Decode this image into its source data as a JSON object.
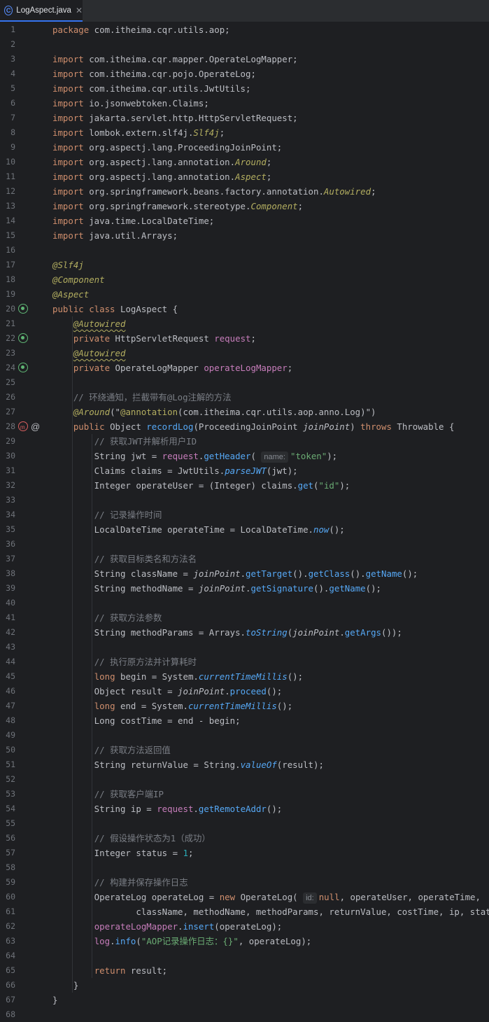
{
  "tab": {
    "icon": "class-icon",
    "label": "LogAspect.java",
    "close_icon": "close-icon"
  },
  "hints": {
    "name": "name:",
    "id": "id:"
  },
  "lines": [
    [
      [
        "kw",
        "package"
      ],
      [
        "t",
        " com.itheima.cqr.utils.aop;"
      ]
    ],
    [],
    [
      [
        "kw",
        "import"
      ],
      [
        "t",
        " com.itheima.cqr.mapper.OperateLogMapper;"
      ]
    ],
    [
      [
        "kw",
        "import"
      ],
      [
        "t",
        " com.itheima.cqr.pojo.OperateLog;"
      ]
    ],
    [
      [
        "kw",
        "import"
      ],
      [
        "t",
        " com.itheima.cqr.utils.JwtUtils;"
      ]
    ],
    [
      [
        "kw",
        "import"
      ],
      [
        "t",
        " io.jsonwebtoken.Claims;"
      ]
    ],
    [
      [
        "kw",
        "import"
      ],
      [
        "t",
        " jakarta.servlet.http.HttpServletRequest;"
      ]
    ],
    [
      [
        "kw",
        "import"
      ],
      [
        "t",
        " lombok.extern.slf4j."
      ],
      [
        "an it",
        "Slf4j"
      ],
      [
        "t",
        ";"
      ]
    ],
    [
      [
        "kw",
        "import"
      ],
      [
        "t",
        " org.aspectj.lang.ProceedingJoinPoint;"
      ]
    ],
    [
      [
        "kw",
        "import"
      ],
      [
        "t",
        " org.aspectj.lang.annotation."
      ],
      [
        "an it",
        "Around"
      ],
      [
        "t",
        ";"
      ]
    ],
    [
      [
        "kw",
        "import"
      ],
      [
        "t",
        " org.aspectj.lang.annotation."
      ],
      [
        "an it",
        "Aspect"
      ],
      [
        "t",
        ";"
      ]
    ],
    [
      [
        "kw",
        "import"
      ],
      [
        "t",
        " org.springframework.beans.factory.annotation."
      ],
      [
        "an it",
        "Autowired"
      ],
      [
        "t",
        ";"
      ]
    ],
    [
      [
        "kw",
        "import"
      ],
      [
        "t",
        " org.springframework.stereotype."
      ],
      [
        "an it",
        "Component"
      ],
      [
        "t",
        ";"
      ]
    ],
    [
      [
        "kw",
        "import"
      ],
      [
        "t",
        " java.time.LocalDateTime;"
      ]
    ],
    [
      [
        "kw",
        "import"
      ],
      [
        "t",
        " java.util.Arrays;"
      ]
    ],
    [],
    [
      [
        "an it",
        "@Slf4j"
      ]
    ],
    [
      [
        "an it",
        "@Component"
      ]
    ],
    [
      [
        "an it",
        "@Aspect"
      ]
    ],
    [
      [
        "kw",
        "public class"
      ],
      [
        "t",
        " LogAspect {"
      ]
    ],
    [
      [
        "t",
        "    "
      ],
      [
        "an it sq",
        "@Autowired"
      ]
    ],
    [
      [
        "t",
        "    "
      ],
      [
        "kw",
        "private"
      ],
      [
        "t",
        " HttpServletRequest "
      ],
      [
        "fld",
        "request"
      ],
      [
        "t",
        ";"
      ]
    ],
    [
      [
        "t",
        "    "
      ],
      [
        "an it sq",
        "@Autowired"
      ]
    ],
    [
      [
        "t",
        "    "
      ],
      [
        "kw",
        "private"
      ],
      [
        "t",
        " OperateLogMapper "
      ],
      [
        "fld",
        "operateLogMapper"
      ],
      [
        "t",
        ";"
      ]
    ],
    [],
    [
      [
        "t",
        "    "
      ],
      [
        "cm",
        "// 环绕通知，拦截带有@Log注解的方法"
      ]
    ],
    [
      [
        "t",
        "    "
      ],
      [
        "an it",
        "@Around"
      ],
      [
        "t",
        "(\""
      ],
      [
        "an",
        "@annotation"
      ],
      [
        "t",
        "(com.itheima.cqr.utils.aop.anno.Log)\")"
      ]
    ],
    [
      [
        "t",
        "    "
      ],
      [
        "kw",
        "public"
      ],
      [
        "t",
        " Object "
      ],
      [
        "fn",
        "recordLog"
      ],
      [
        "t",
        "(ProceedingJoinPoint "
      ],
      [
        "pm",
        "joinPoint"
      ],
      [
        "t",
        ") "
      ],
      [
        "kw",
        "throws"
      ],
      [
        "t",
        " Throwable {"
      ]
    ],
    [
      [
        "t",
        "        "
      ],
      [
        "cm",
        "// 获取JWT并解析用户ID"
      ]
    ],
    [
      [
        "t",
        "        String jwt = "
      ],
      [
        "fld",
        "request"
      ],
      [
        "t",
        "."
      ],
      [
        "fn",
        "getHeader"
      ],
      [
        "t",
        "( "
      ],
      [
        "hint",
        "name:"
      ],
      [
        "str",
        "\"token\""
      ],
      [
        "t",
        ");"
      ]
    ],
    [
      [
        "t",
        "        Claims claims = JwtUtils."
      ],
      [
        "fn it",
        "parseJWT"
      ],
      [
        "t",
        "(jwt);"
      ]
    ],
    [
      [
        "t",
        "        Integer operateUser = (Integer) claims."
      ],
      [
        "fn",
        "get"
      ],
      [
        "t",
        "("
      ],
      [
        "str",
        "\"id\""
      ],
      [
        "t",
        ");"
      ]
    ],
    [],
    [
      [
        "t",
        "        "
      ],
      [
        "cm",
        "// 记录操作时间"
      ]
    ],
    [
      [
        "t",
        "        LocalDateTime operateTime = LocalDateTime."
      ],
      [
        "fn it",
        "now"
      ],
      [
        "t",
        "();"
      ]
    ],
    [],
    [
      [
        "t",
        "        "
      ],
      [
        "cm",
        "// 获取目标类名和方法名"
      ]
    ],
    [
      [
        "t",
        "        String className = "
      ],
      [
        "pm",
        "joinPoint"
      ],
      [
        "t",
        "."
      ],
      [
        "fn",
        "getTarget"
      ],
      [
        "t",
        "()."
      ],
      [
        "fn",
        "getClass"
      ],
      [
        "t",
        "()."
      ],
      [
        "fn",
        "getName"
      ],
      [
        "t",
        "();"
      ]
    ],
    [
      [
        "t",
        "        String methodName = "
      ],
      [
        "pm",
        "joinPoint"
      ],
      [
        "t",
        "."
      ],
      [
        "fn",
        "getSignature"
      ],
      [
        "t",
        "()."
      ],
      [
        "fn",
        "getName"
      ],
      [
        "t",
        "();"
      ]
    ],
    [],
    [
      [
        "t",
        "        "
      ],
      [
        "cm",
        "// 获取方法参数"
      ]
    ],
    [
      [
        "t",
        "        String methodParams = Arrays."
      ],
      [
        "fn it",
        "toString"
      ],
      [
        "t",
        "("
      ],
      [
        "pm",
        "joinPoint"
      ],
      [
        "t",
        "."
      ],
      [
        "fn",
        "getArgs"
      ],
      [
        "t",
        "());"
      ]
    ],
    [],
    [
      [
        "t",
        "        "
      ],
      [
        "cm",
        "// 执行原方法并计算耗时"
      ]
    ],
    [
      [
        "t",
        "        "
      ],
      [
        "kw",
        "long"
      ],
      [
        "t",
        " begin = System."
      ],
      [
        "fn it",
        "currentTimeMillis"
      ],
      [
        "t",
        "();"
      ]
    ],
    [
      [
        "t",
        "        Object result = "
      ],
      [
        "pm",
        "joinPoint"
      ],
      [
        "t",
        "."
      ],
      [
        "fn",
        "proceed"
      ],
      [
        "t",
        "();"
      ]
    ],
    [
      [
        "t",
        "        "
      ],
      [
        "kw",
        "long"
      ],
      [
        "t",
        " end = System."
      ],
      [
        "fn it",
        "currentTimeMillis"
      ],
      [
        "t",
        "();"
      ]
    ],
    [
      [
        "t",
        "        Long costTime = end - begin;"
      ]
    ],
    [],
    [
      [
        "t",
        "        "
      ],
      [
        "cm",
        "// 获取方法返回值"
      ]
    ],
    [
      [
        "t",
        "        String returnValue = String."
      ],
      [
        "fn it",
        "valueOf"
      ],
      [
        "t",
        "(result);"
      ]
    ],
    [],
    [
      [
        "t",
        "        "
      ],
      [
        "cm",
        "// 获取客户端IP"
      ]
    ],
    [
      [
        "t",
        "        String ip = "
      ],
      [
        "fld",
        "request"
      ],
      [
        "t",
        "."
      ],
      [
        "fn",
        "getRemoteAddr"
      ],
      [
        "t",
        "();"
      ]
    ],
    [],
    [
      [
        "t",
        "        "
      ],
      [
        "cm",
        "// 假设操作状态为1（成功）"
      ]
    ],
    [
      [
        "t",
        "        Integer status = "
      ],
      [
        "num",
        "1"
      ],
      [
        "t",
        ";"
      ]
    ],
    [],
    [
      [
        "t",
        "        "
      ],
      [
        "cm",
        "// 构建并保存操作日志"
      ]
    ],
    [
      [
        "t",
        "        OperateLog operateLog = "
      ],
      [
        "kw",
        "new"
      ],
      [
        "t",
        " OperateLog( "
      ],
      [
        "hint",
        "id:"
      ],
      [
        "kw",
        "null"
      ],
      [
        "t",
        ", operateUser, operateTime,"
      ]
    ],
    [
      [
        "t",
        "                className, methodName, methodParams, returnValue, costTime, ip, status);"
      ]
    ],
    [
      [
        "t",
        "        "
      ],
      [
        "fld",
        "operateLogMapper"
      ],
      [
        "t",
        "."
      ],
      [
        "fn",
        "insert"
      ],
      [
        "t",
        "(operateLog);"
      ]
    ],
    [
      [
        "t",
        "        "
      ],
      [
        "fld",
        "log"
      ],
      [
        "t",
        "."
      ],
      [
        "fn",
        "info"
      ],
      [
        "t",
        "("
      ],
      [
        "str",
        "\"AOP记录操作日志：{}\""
      ],
      [
        "t",
        ", operateLog);"
      ]
    ],
    [],
    [
      [
        "t",
        "        "
      ],
      [
        "kw",
        "return"
      ],
      [
        "t",
        " result;"
      ]
    ],
    [
      [
        "t",
        "    }"
      ]
    ],
    [
      [
        "t",
        "}"
      ]
    ],
    []
  ],
  "gutter_icons": [
    {
      "line": 20,
      "icons": [
        "spring-bean-icon"
      ]
    },
    {
      "line": 22,
      "icons": [
        "autowired-bean-icon"
      ]
    },
    {
      "line": 24,
      "icons": [
        "autowired-bean-icon"
      ]
    },
    {
      "line": 28,
      "icons": [
        "aop-advice-icon",
        "annotation-at-icon"
      ]
    }
  ]
}
